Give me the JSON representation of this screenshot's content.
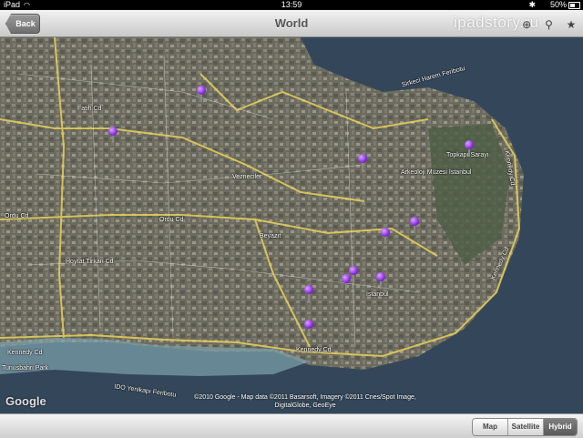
{
  "status": {
    "device": "iPad",
    "time": "13:59",
    "battery": "50%",
    "battery_level": 0.5
  },
  "nav": {
    "back_label": "Back",
    "title": "World",
    "watermark": "ipadstory.ru"
  },
  "map": {
    "labels": [
      {
        "id": "kennedy1",
        "text": "Kennedy Cd"
      },
      {
        "id": "kennedy2",
        "text": "Kennedy Cd"
      },
      {
        "id": "kennedy3",
        "text": "Kennedy Cd"
      },
      {
        "id": "kennedy4",
        "text": "Kennedy Cd"
      },
      {
        "id": "ordu",
        "text": "Ordu Cd"
      },
      {
        "id": "ordu2",
        "text": "Ordu Cd"
      },
      {
        "id": "tuvankarasi",
        "text": "Hoyrat Tirkan Cd"
      },
      {
        "id": "istanbul",
        "text": "İstanbul"
      },
      {
        "id": "topkapi",
        "text": "Topkapı Sarayı"
      },
      {
        "id": "arkeoloji",
        "text": "Arkeoloji Müzesi İstanbul"
      },
      {
        "id": "sirkeci",
        "text": "Sirkeci Harem Feribotu"
      },
      {
        "id": "yenikapi",
        "text": "IDO Yenikapı Feribotu"
      },
      {
        "id": "tunusbagi",
        "text": "Tunusbahri Park"
      },
      {
        "id": "vatan",
        "text": "Vezneciler"
      },
      {
        "id": "fatih",
        "text": "Fatih Cd"
      },
      {
        "id": "beyazit",
        "text": "Beyazıt"
      }
    ],
    "google_logo": "Google",
    "copyright": "©2010 Google - Map data ©2011 Basarsoft, Imagery ©2011 Cnes/Spot Image, DigitalGlobe, GeoEye"
  },
  "segments": [
    {
      "label": "Map",
      "active": false
    },
    {
      "label": "Satellite",
      "active": false
    },
    {
      "label": "Hybrid",
      "active": true
    }
  ]
}
